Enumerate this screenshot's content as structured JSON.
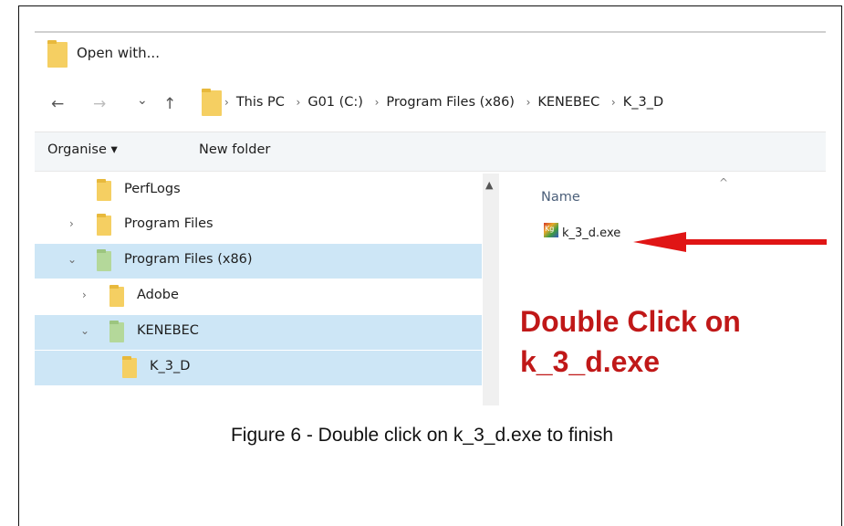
{
  "dialog": {
    "title": "Open with..."
  },
  "address": {
    "nav_back": "←",
    "nav_forward": "→",
    "nav_recent": "⌄",
    "nav_up": "↑",
    "separator": "›",
    "crumbs": [
      "This PC",
      "G01 (C:)",
      "Program Files (x86)",
      "KENEBEC",
      "K_3_D"
    ]
  },
  "toolbar": {
    "organise_label": "Organise ▾",
    "new_folder_label": "New folder"
  },
  "tree": {
    "items": [
      {
        "label": "PerfLogs",
        "chevron": ""
      },
      {
        "label": "Program Files",
        "chevron": "›"
      },
      {
        "label": "Program Files (x86)",
        "chevron": "⌄"
      },
      {
        "label": "Adobe",
        "chevron": "›"
      },
      {
        "label": "KENEBEC",
        "chevron": "⌄"
      },
      {
        "label": "K_3_D",
        "chevron": ""
      }
    ]
  },
  "list": {
    "column_header": "Name",
    "sort_glyph": "^",
    "file": {
      "name": "k_3_d.exe",
      "icon": "kenebec-app-icon",
      "icon_text": "Kg"
    }
  },
  "annotation": {
    "line1": "Double Click on",
    "line2": "k_3_d.exe",
    "color": "#c01818"
  },
  "caption": "Figure 6 - Double click on k_3_d.exe to finish"
}
